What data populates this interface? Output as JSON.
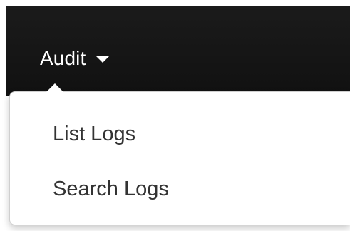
{
  "navbar": {
    "dropdown_label": "Audit"
  },
  "dropdown": {
    "items": [
      {
        "label": "List Logs"
      },
      {
        "label": "Search Logs"
      }
    ]
  }
}
